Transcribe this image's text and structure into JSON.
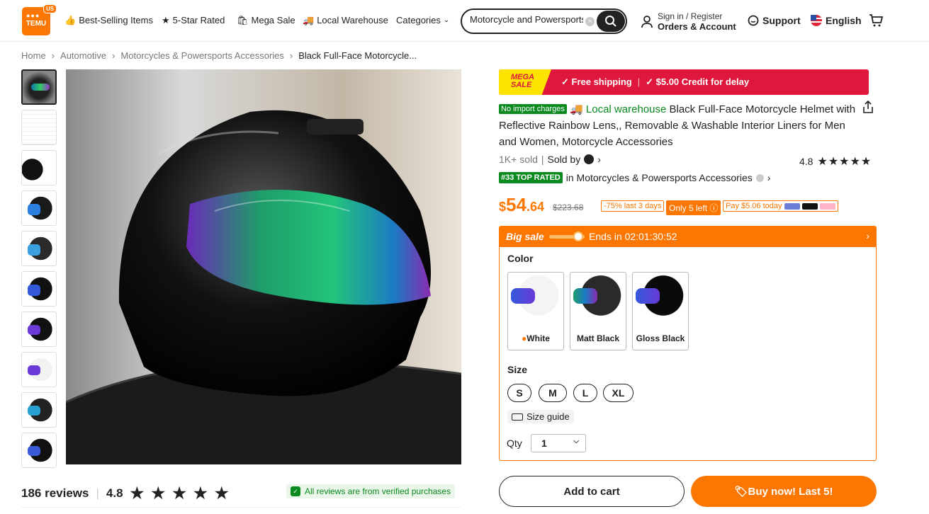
{
  "header": {
    "logo_text": "TEMU",
    "region_badge": "US",
    "nav": [
      "Best-Selling Items",
      "5-Star Rated",
      "Mega Sale",
      "Local Warehouse",
      "Categories"
    ],
    "search_value": "Motorcycle and Powersports",
    "sign_in": "Sign in / Register",
    "orders": "Orders & Account",
    "support": "Support",
    "language": "English"
  },
  "breadcrumb": [
    "Home",
    "Automotive",
    "Motorcycles & Powersports Accessories",
    "Black Full-Face Motorcycle..."
  ],
  "reviews": {
    "count_label": "186 reviews",
    "rating": "4.8",
    "stars": "★ ★ ★ ★ ★",
    "verified": "All reviews are from verified purchases"
  },
  "product": {
    "banner_mega": "MEGA SALE",
    "banner_shipping": "✓ Free shipping",
    "banner_sep": "|",
    "banner_credit": "✓ $5.00 Credit for delay",
    "import_badge": "No import charges",
    "local_warehouse": "Local warehouse",
    "title": "Black Full-Face Motorcycle Helmet with Reflective Rainbow Lens,, Removable & Washable Interior Liners for Men and Women, Motorcycle Accessories",
    "sold": "1K+ sold",
    "sold_by": "Sold by",
    "rating": "4.8",
    "stars": "★★★★★",
    "top_rated_badge": "#33 TOP RATED",
    "top_rated_in": "in Motorcycles & Powersports Accessories",
    "price_currency": "$",
    "price_whole": "54",
    "price_cents": ".64",
    "old_price": "$223.68",
    "discount": "-75% last 3 days",
    "stock": "Only 5 left",
    "pay_today": "Pay $5.06 today",
    "big_sale": "Big sale",
    "ends": "Ends in 02:01:30:52",
    "color_label": "Color",
    "colors": [
      "White",
      "Matt Black",
      "Gloss Black"
    ],
    "size_label": "Size",
    "sizes": [
      "S",
      "M",
      "L",
      "XL"
    ],
    "size_guide": "Size guide",
    "qty_label": "Qty",
    "qty_value": "1",
    "add_to_cart": "Add to cart",
    "buy_now": "Buy now! Last 5!"
  },
  "colors": {
    "accent": "#fb7701",
    "green": "#0a8a1f",
    "banner_red": "#e0173c",
    "mega_yellow": "#fce300"
  },
  "icons": [
    "thumbs-up-icon",
    "star-badge-icon",
    "bag-icon",
    "truck-icon",
    "chevron-down-icon",
    "search-icon",
    "user-icon",
    "chat-icon",
    "flag-us-icon",
    "cart-icon",
    "share-icon",
    "shield-check-icon",
    "ruler-icon"
  ]
}
